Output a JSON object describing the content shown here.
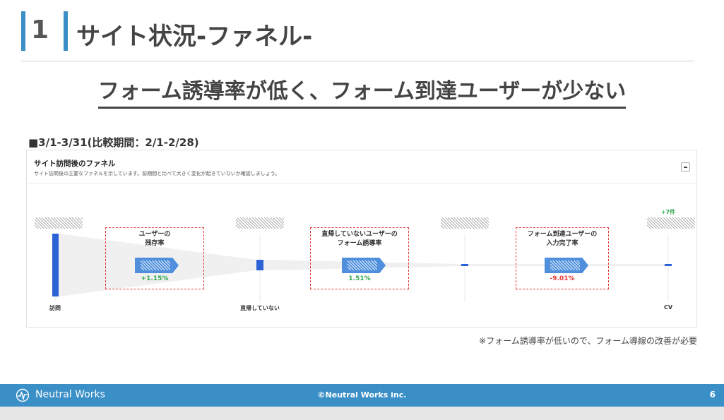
{
  "header": {
    "number": "1",
    "title": "サイト状況-ファネル-"
  },
  "headline": "フォーム誘導率が低く、フォーム到達ユーザーが少ない",
  "period": "■3/1-3/31(比較期間：2/1-2/28)",
  "panel": {
    "title": "サイト訪問後のファネル",
    "description": "サイト訪問後の主要なファネルを示しています。前期間と比べて大きく変化が起きていないか確認しましょう。",
    "stages": [
      {
        "label": "訪問",
        "delta": ""
      },
      {
        "label": "直帰していない",
        "delta": ""
      },
      {
        "label": "",
        "delta": ""
      },
      {
        "label": "CV",
        "delta": "+7件"
      }
    ],
    "conversions": [
      {
        "title": "ユーザーの\n残存率",
        "rate": "+1.15%",
        "rate_color": "#2fa84f"
      },
      {
        "title": "直帰していないユーザーの\nフォーム誘導率",
        "rate": "1.51%",
        "rate_color": "#2fa84f"
      },
      {
        "title": "フォーム到達ユーザーの\n入力完了率",
        "rate": "-9.01%",
        "rate_color": "#e53935"
      }
    ],
    "colors": {
      "bar": "#2b62d6",
      "funnel_fill": "#f0f0f0"
    }
  },
  "footnote": "※フォーム誘導率が低いので、フォーム導線の改善が必要",
  "footer": {
    "brand": "Neutral Works",
    "copyright": "©Neutral Works inc.",
    "page_number": "6",
    "color": "#3a8fc7"
  }
}
